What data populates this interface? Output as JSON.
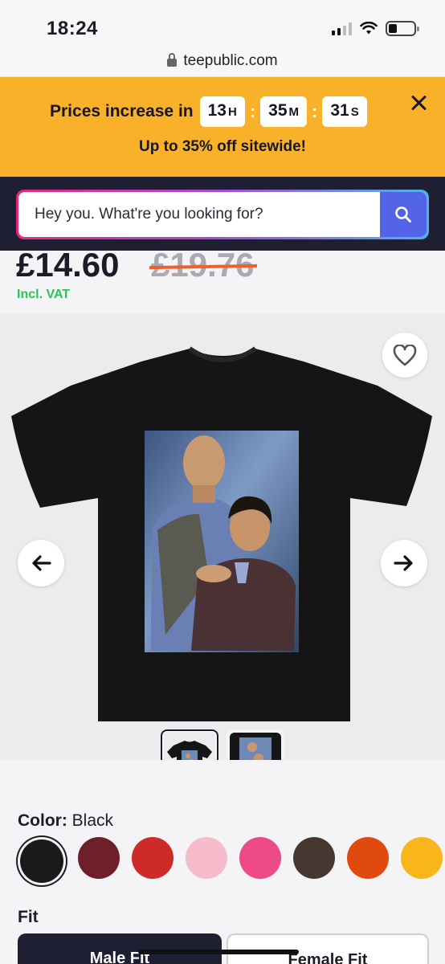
{
  "status_bar": {
    "time": "18:24"
  },
  "browser": {
    "url": "teepublic.com"
  },
  "promo": {
    "text": "Prices increase in",
    "hours": "13",
    "hours_unit": "H",
    "minutes": "35",
    "minutes_unit": "M",
    "seconds": "31",
    "seconds_unit": "S",
    "subtitle": "Up to 35% off sitewide!"
  },
  "search": {
    "placeholder": "Hey you. What're you looking for?"
  },
  "product": {
    "price": "£14.60",
    "old_price": "£19.76",
    "vat_note": "Incl. VAT"
  },
  "color": {
    "label": "Color:",
    "selected": "Black",
    "swatches": [
      "#1a1a1a",
      "#6e1f2a",
      "#cf2a2a",
      "#f7bccb",
      "#ee4a86",
      "#463830",
      "#e04a0f",
      "#f8b61c"
    ]
  },
  "fit": {
    "label": "Fit",
    "options": [
      "Male Fit",
      "Female Fit"
    ]
  },
  "colors": {
    "promo_bg": "#f9b12a",
    "search_strip": "#1e1f33",
    "accent_blue": "#5464e8",
    "vat_green": "#2ec05a",
    "strike": "#ef5f2a"
  }
}
